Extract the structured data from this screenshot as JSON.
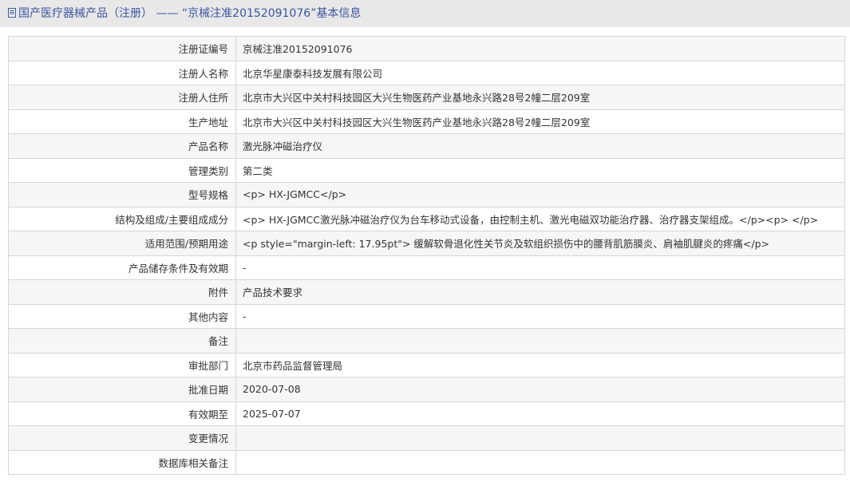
{
  "header": {
    "prefix": "国产医疗器械产品（注册）",
    "separator": " —— ",
    "record_title": "“京械注准20152091076”基本信息"
  },
  "rows": [
    {
      "label": "注册证编号",
      "value": "京械注准20152091076"
    },
    {
      "label": "注册人名称",
      "value": "北京华星康泰科技发展有限公司"
    },
    {
      "label": "注册人住所",
      "value": "北京市大兴区中关村科技园区大兴生物医药产业基地永兴路28号2幢二层209室"
    },
    {
      "label": "生产地址",
      "value": "北京市大兴区中关村科技园区大兴生物医药产业基地永兴路28号2幢二层209室"
    },
    {
      "label": "产品名称",
      "value": "激光脉冲磁治疗仪"
    },
    {
      "label": "管理类别",
      "value": "第二类"
    },
    {
      "label": "型号规格",
      "value": "<p> HX-JGMCC</p>"
    },
    {
      "label": "结构及组成/主要组成成分",
      "value": "<p> HX-JGMCC激光脉冲磁治疗仪为台车移动式设备，由控制主机、激光电磁双功能治疗器、治疗器支架组成。</p><p> </p>"
    },
    {
      "label": "适用范围/预期用途",
      "value": "<p style=\"margin-left: 17.95pt\"> 缓解软骨退化性关节炎及软组织损伤中的腰背肌筋膜炎、肩袖肌腱炎的疼痛</p>"
    },
    {
      "label": "产品储存条件及有效期",
      "value": "-"
    },
    {
      "label": "附件",
      "value": "产品技术要求"
    },
    {
      "label": "其他内容",
      "value": "-"
    },
    {
      "label": "备注",
      "value": ""
    },
    {
      "label": "审批部门",
      "value": "北京市药品监督管理局"
    },
    {
      "label": "批准日期",
      "value": "2020-07-08"
    },
    {
      "label": "有效期至",
      "value": "2025-07-07"
    },
    {
      "label": "变更情况",
      "value": ""
    },
    {
      "label": "数据库相关备注",
      "value": ""
    }
  ]
}
